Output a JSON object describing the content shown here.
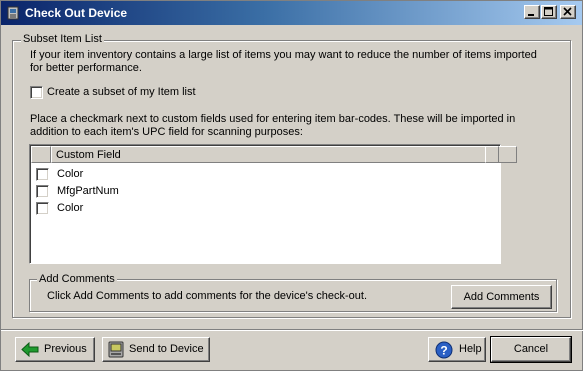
{
  "window": {
    "title": "Check Out Device"
  },
  "subset_group": {
    "legend": "Subset Item List",
    "description": "If your item inventory contains a large list of items you may want to reduce the number of items imported for better performance.",
    "subset_checkbox_label": "Create a subset of my Item list",
    "custom_fields_description": "Place a checkmark next to custom fields used for entering item bar-codes. These will be imported in addition to each item's UPC field for scanning purposes:",
    "list": {
      "column_header": "Custom Field",
      "rows": [
        "Color",
        "MfgPartNum",
        "Color"
      ]
    }
  },
  "comments_group": {
    "legend": "Add Comments",
    "description": "Click Add Comments to add comments for the device's check-out.",
    "button": "Add Comments"
  },
  "footer": {
    "previous": "Previous",
    "send": "Send to Device",
    "help": "Help",
    "cancel": "Cancel"
  }
}
